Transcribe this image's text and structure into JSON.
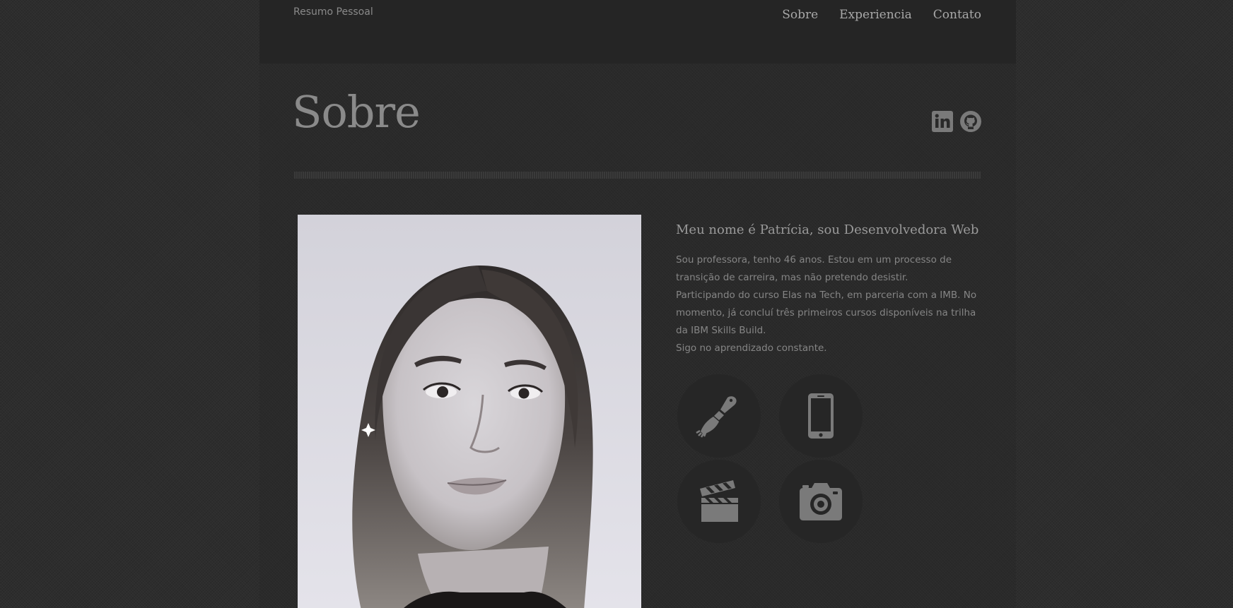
{
  "header": {
    "brand": "Resumo Pessoal",
    "nav": [
      {
        "label": "Sobre"
      },
      {
        "label": "Experiencia"
      },
      {
        "label": "Contato"
      }
    ]
  },
  "main": {
    "title": "Sobre",
    "social": [
      {
        "icon": "linkedin-icon"
      },
      {
        "icon": "github-icon"
      }
    ],
    "bio": {
      "heading": "Meu nome é Patrícia, sou Desenvolvedora Web",
      "paragraphs": [
        "Sou professora, tenho 46 anos. Estou em um processo de transição de carreira, mas não pretendo desistir.",
        "Participando do curso Elas na Tech, em parceria com a IMB. No momento, já concluí três primeiros cursos disponíveis na trilha da IBM Skills Build.",
        "Sigo no aprendizado constante."
      ]
    },
    "skills": [
      {
        "icon": "paintbrush-icon"
      },
      {
        "icon": "smartphone-icon"
      },
      {
        "icon": "clapperboard-icon"
      },
      {
        "icon": "camera-icon"
      }
    ]
  },
  "colors": {
    "background": "#2d2d2d",
    "page": "#2a2a2a",
    "header": "#252525",
    "text": "#858585",
    "title": "#8a8a8a",
    "skill_circle": "#262626",
    "icon": "#7a7a7a"
  }
}
